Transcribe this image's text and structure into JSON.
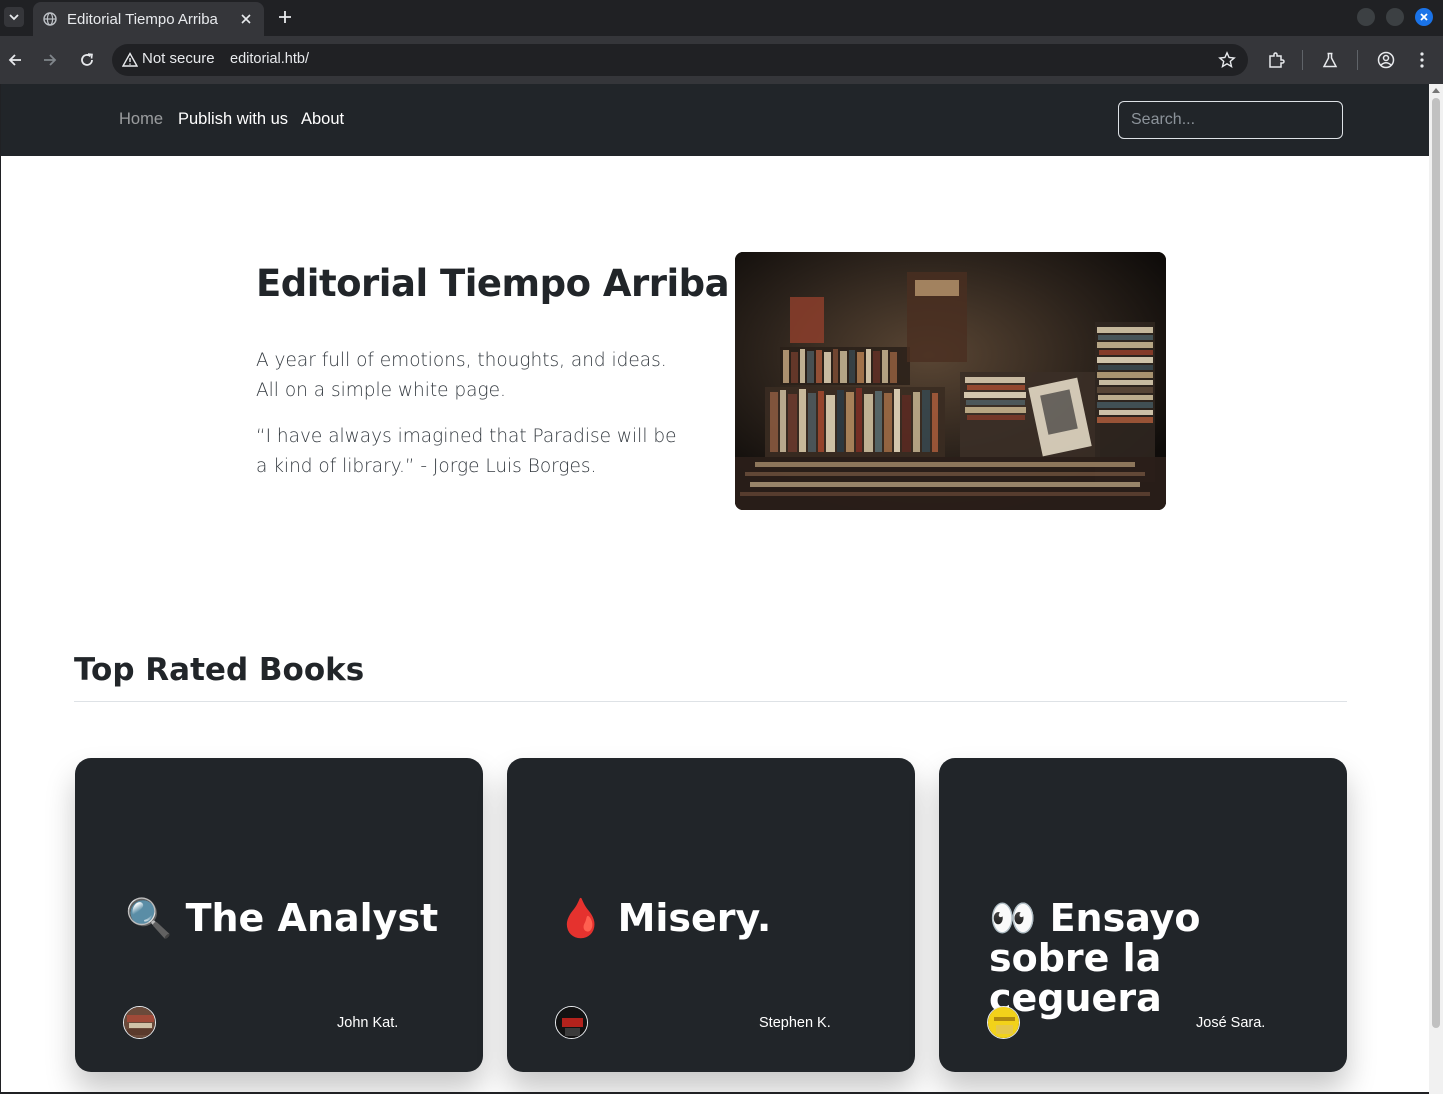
{
  "browser": {
    "tab_title": "Editorial Tiempo Arriba",
    "security_label": "Not secure",
    "url": "editorial.htb/"
  },
  "nav": {
    "links": [
      "Home",
      "Publish with us",
      "About"
    ],
    "search_placeholder": "Search..."
  },
  "hero": {
    "title": "Editorial Tiempo Arriba",
    "paragraph1": "A year full of emotions, thoughts, and ideas. All on a simple white page.",
    "paragraph2": "“I have always imagined that Paradise will be a kind of library.” - Jorge Luis Borges."
  },
  "section": {
    "title": "Top Rated Books"
  },
  "books": [
    {
      "emoji": "🔍",
      "title": "The Analyst",
      "author": "John Kat."
    },
    {
      "emoji": "🩸",
      "title": "Misery.",
      "author": "Stephen K."
    },
    {
      "emoji": "👀",
      "title": "Ensayo sobre la ceguera",
      "author": "José Sara."
    }
  ],
  "colors": {
    "nav_bg": "#212529",
    "card_bg": "#212529",
    "chrome_bg": "#202124",
    "accent_blue": "#1a73e8"
  }
}
